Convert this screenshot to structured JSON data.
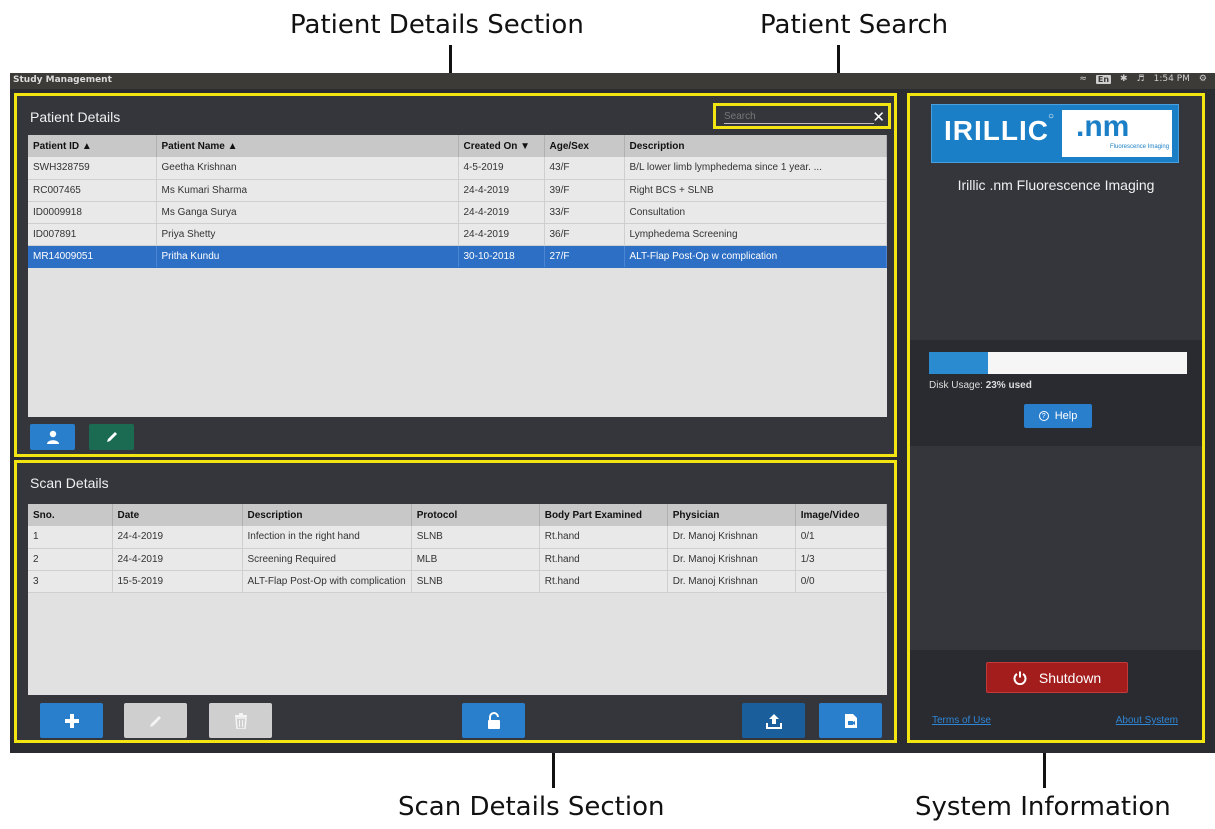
{
  "annotations": {
    "patient_details_section": "Patient Details Section",
    "patient_search": "Patient Search",
    "scan_details_section": "Scan Details Section",
    "system_information": "System Information"
  },
  "window": {
    "title": "Study Management",
    "tray": {
      "keyboard": "En",
      "time": "1:54 PM"
    }
  },
  "patients": {
    "title": "Patient Details",
    "search_placeholder": "Search",
    "columns": [
      "Patient ID ▲",
      "Patient Name ▲",
      "Created On ▼",
      "Age/Sex",
      "Description"
    ],
    "rows": [
      [
        "SWH328759",
        "Geetha Krishnan",
        "4-5-2019",
        "43/F",
        "B/L lower limb lymphedema since 1 year. ..."
      ],
      [
        "RC007465",
        "Ms Kumari Sharma",
        "24-4-2019",
        "39/F",
        "Right BCS + SLNB"
      ],
      [
        "ID0009918",
        "Ms Ganga Surya",
        "24-4-2019",
        "33/F",
        "Consultation"
      ],
      [
        "ID007891",
        "Priya Shetty",
        "24-4-2019",
        "36/F",
        "Lymphedema Screening"
      ],
      [
        "MR14009051",
        "Pritha Kundu",
        "30-10-2018",
        "27/F",
        "ALT-Flap Post-Op w complication"
      ]
    ],
    "selected_row": 4
  },
  "scans": {
    "title": "Scan Details",
    "columns": [
      "Sno.",
      "Date",
      "Description",
      "Protocol",
      "Body Part Examined",
      "Physician",
      "Image/Video"
    ],
    "rows": [
      [
        "1",
        "24-4-2019",
        "Infection in the right hand",
        "SLNB",
        "Rt.hand",
        "Dr. Manoj Krishnan",
        "0/1"
      ],
      [
        "2",
        "24-4-2019",
        "Screening Required",
        "MLB",
        "Rt.hand",
        "Dr. Manoj Krishnan",
        "1/3"
      ],
      [
        "3",
        "15-5-2019",
        "ALT-Flap Post-Op with complication",
        "SLNB",
        "Rt.hand",
        "Dr. Manoj Krishnan",
        "0/0"
      ]
    ]
  },
  "system": {
    "logo_text": "IRILLIC",
    "logo_badge": ".nm",
    "logo_sub": "Fluorescence Imaging",
    "product_name": "Irillic .nm Fluorescence Imaging",
    "disk_label": "Disk Usage: ",
    "disk_value": "23% used",
    "disk_fraction": 0.23,
    "help_label": "Help",
    "shutdown_label": "Shutdown",
    "terms_label": "Terms of Use",
    "about_label": "About System"
  },
  "colors": {
    "highlight": "#f2e512",
    "selected_row": "#2d6fc4",
    "shutdown": "#a31d1d",
    "accent": "#2a7fcc"
  }
}
